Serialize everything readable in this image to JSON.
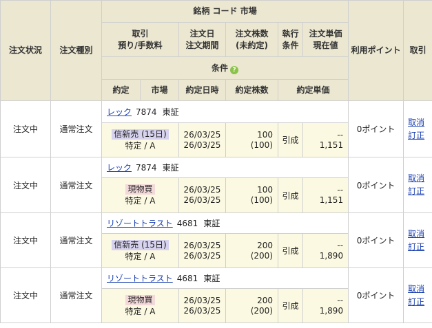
{
  "header": {
    "status": "注文状況",
    "type": "注文種別",
    "meigara": "銘柄 コード 市場",
    "torihiki_1": "取引",
    "torihiki_2": "預り/手数料",
    "date_1": "注文日",
    "date_2": "注文期間",
    "qty_1": "注文株数",
    "qty_2": "(未約定)",
    "exec_1": "執行",
    "exec_2": "条件",
    "price_1": "注文単価",
    "price_2": "現在値",
    "points": "利用ポイント",
    "torikeshi": "取引",
    "condition": "条件",
    "help_icon": "question-circle",
    "yakujo": "約定",
    "market": "市場",
    "yakujo_date": "約定日時",
    "yakujo_qty": "約定株数",
    "yakujo_price": "約定単価"
  },
  "colors": {
    "header_bg": "#ebe7d1",
    "sub_bg": "#fbf9e1",
    "link": "#1a3fb0",
    "shinyo_tag_bg": "#d7d2ee",
    "genbutsu_tag_bg": "#f4d9db"
  },
  "orders": [
    {
      "status": "注文中",
      "type": "通常注文",
      "name": "レック",
      "code": "7874",
      "market": "東証",
      "trade": "信新売 (15日)",
      "trade_kind": "shinyo",
      "account": "特定 / A",
      "date1": "26/03/25",
      "date2": "26/03/25",
      "qty": "100",
      "qty_open": "(100)",
      "exec": "引成",
      "price": "--",
      "current": "1,151",
      "points": "0ポイント",
      "cancel": "取消",
      "correct": "訂正"
    },
    {
      "status": "注文中",
      "type": "通常注文",
      "name": "レック",
      "code": "7874",
      "market": "東証",
      "trade": "現物買",
      "trade_kind": "genbutsu",
      "account": "特定 / A",
      "date1": "26/03/25",
      "date2": "26/03/25",
      "qty": "100",
      "qty_open": "(100)",
      "exec": "引成",
      "price": "--",
      "current": "1,151",
      "points": "0ポイント",
      "cancel": "取消",
      "correct": "訂正"
    },
    {
      "status": "注文中",
      "type": "通常注文",
      "name": "リゾートトラスト",
      "code": "4681",
      "market": "東証",
      "trade": "信新売 (15日)",
      "trade_kind": "shinyo",
      "account": "特定 / A",
      "date1": "26/03/25",
      "date2": "26/03/25",
      "qty": "200",
      "qty_open": "(200)",
      "exec": "引成",
      "price": "--",
      "current": "1,890",
      "points": "0ポイント",
      "cancel": "取消",
      "correct": "訂正"
    },
    {
      "status": "注文中",
      "type": "通常注文",
      "name": "リゾートトラスト",
      "code": "4681",
      "market": "東証",
      "trade": "現物買",
      "trade_kind": "genbutsu",
      "account": "特定 / A",
      "date1": "26/03/25",
      "date2": "26/03/25",
      "qty": "200",
      "qty_open": "(200)",
      "exec": "引成",
      "price": "--",
      "current": "1,890",
      "points": "0ポイント",
      "cancel": "取消",
      "correct": "訂正"
    }
  ]
}
